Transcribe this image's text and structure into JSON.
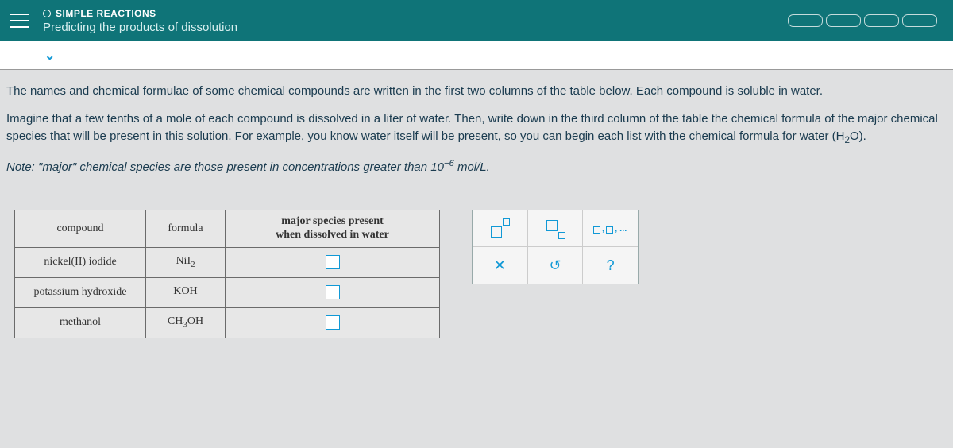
{
  "header": {
    "category": "SIMPLE REACTIONS",
    "title": "Predicting the products of dissolution"
  },
  "content": {
    "p1": "The names and chemical formulae of some chemical compounds are written in the first two columns of the table below. Each compound is soluble in water.",
    "p2_a": "Imagine that a few tenths of a mole of each compound is dissolved in a liter of water. Then, write down in the third column of the table the chemical formula of the major chemical species that will be present in this solution. For example, you know water itself will be present, so you can begin each list with the chemical formula for water ",
    "p2_water_pre": "(H",
    "p2_water_sub": "2",
    "p2_water_post": "O).",
    "note_a": "Note: ",
    "note_b": "\"major\" chemical species are those present in concentrations greater than ",
    "note_base": "10",
    "note_exp": "−6",
    "note_c": " mol/L."
  },
  "table": {
    "headers": {
      "compound": "compound",
      "formula": "formula",
      "major_l1": "major species present",
      "major_l2": "when dissolved in water"
    },
    "rows": [
      {
        "compound": "nickel(II) iodide",
        "f_pre": "NiI",
        "f_sub": "2",
        "f_post": ""
      },
      {
        "compound": "potassium hydroxide",
        "f_pre": "KOH",
        "f_sub": "",
        "f_post": ""
      },
      {
        "compound": "methanol",
        "f_pre": "CH",
        "f_sub": "3",
        "f_post": "OH"
      }
    ]
  },
  "tools": {
    "x": "✕",
    "reset": "↺",
    "help": "?"
  }
}
